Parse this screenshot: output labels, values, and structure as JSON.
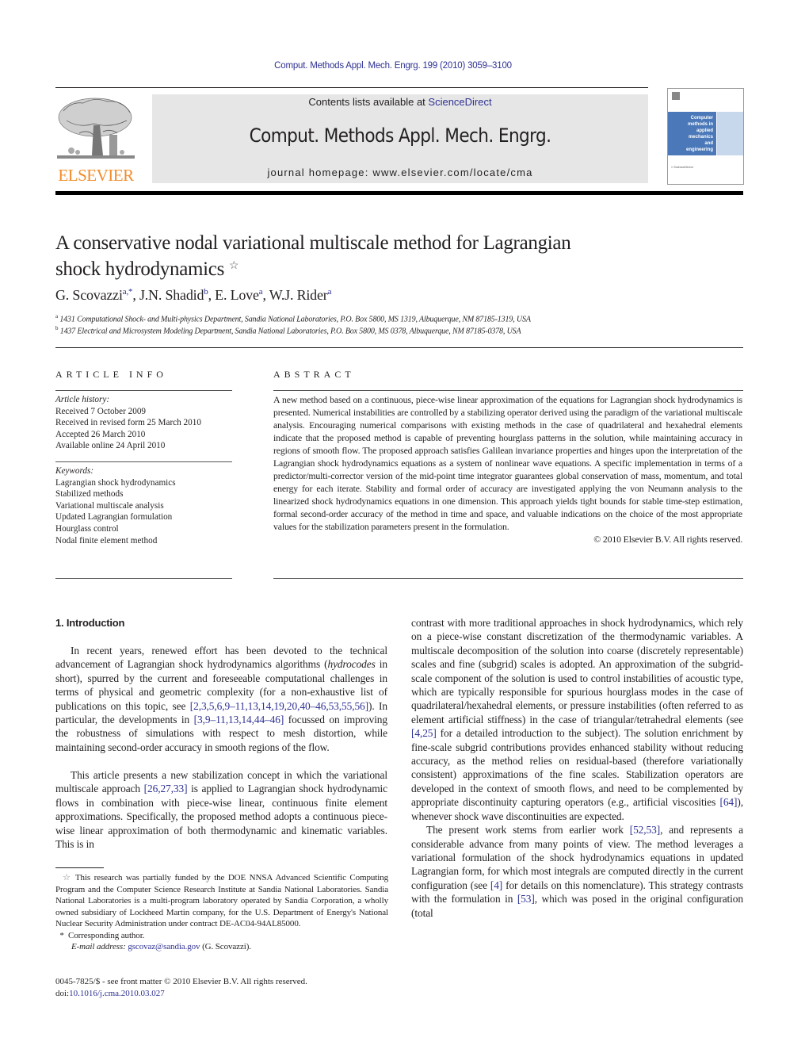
{
  "header": {
    "citation": "Comput. Methods Appl. Mech. Engrg. 199 (2010) 3059–3100",
    "publisher_logo_text": "ELSEVIER",
    "contents_prefix": "Contents lists available at ",
    "contents_link": "ScienceDirect",
    "journal_title": "Comput. Methods Appl. Mech. Engrg.",
    "homepage_prefix": "journal homepage: ",
    "homepage_url": "www.elsevier.com/locate/cma",
    "cover": {
      "lines": [
        "Computer",
        "methods in",
        "applied",
        "mechanics",
        "and",
        "engineering"
      ],
      "colors": {
        "blue": "#4a78b8",
        "light_blue": "#c8d8ec"
      }
    }
  },
  "article": {
    "title_line1": "A conservative nodal variational multiscale method for Lagrangian",
    "title_line2": "shock hydrodynamics",
    "title_mark": "☆",
    "authors": [
      {
        "name": "G. Scovazzi",
        "sup": "a,*"
      },
      {
        "name": "J.N. Shadid",
        "sup": "b"
      },
      {
        "name": "E. Love",
        "sup": "a"
      },
      {
        "name": "W.J. Rider",
        "sup": "a"
      }
    ],
    "affiliations": [
      {
        "label": "a",
        "text": "1431 Computational Shock- and Multi-physics Department, Sandia National Laboratories, P.O. Box 5800, MS 1319, Albuquerque, NM 87185-1319, USA"
      },
      {
        "label": "b",
        "text": "1437 Electrical and Microsystem Modeling Department, Sandia National Laboratories, P.O. Box 5800, MS 0378, Albuquerque, NM 87185-0378, USA"
      }
    ]
  },
  "article_info": {
    "heading": "ARTICLE INFO",
    "history_label": "Article history:",
    "history": [
      "Received 7 October 2009",
      "Received in revised form 25 March 2010",
      "Accepted 26 March 2010",
      "Available online 24 April 2010"
    ],
    "keywords_label": "Keywords:",
    "keywords": [
      "Lagrangian shock hydrodynamics",
      "Stabilized methods",
      "Variational multiscale analysis",
      "Updated Lagrangian formulation",
      "Hourglass control",
      "Nodal finite element method"
    ]
  },
  "abstract": {
    "heading": "ABSTRACT",
    "text": "A new method based on a continuous, piece-wise linear approximation of the equations for Lagrangian shock hydrodynamics is presented. Numerical instabilities are controlled by a stabilizing operator derived using the paradigm of the variational multiscale analysis. Encouraging numerical comparisons with existing methods in the case of quadrilateral and hexahedral elements indicate that the proposed method is capable of preventing hourglass patterns in the solution, while maintaining accuracy in regions of smooth flow. The proposed approach satisfies Galilean invariance properties and hinges upon the interpretation of the Lagrangian shock hydrodynamics equations as a system of nonlinear wave equations. A specific implementation in terms of a predictor/multi-corrector version of the mid-point time integrator guarantees global conservation of mass, momentum, and total energy for each iterate. Stability and formal order of accuracy are investigated applying the von Neumann analysis to the linearized shock hydrodynamics equations in one dimension. This approach yields tight bounds for stable time-step estimation, formal second-order accuracy of the method in time and space, and valuable indications on the choice of the most appropriate values for the stabilization parameters present in the formulation.",
    "copyright": "© 2010 Elsevier B.V. All rights reserved."
  },
  "body": {
    "section_heading": "1. Introduction",
    "p1": {
      "a": "In recent years, renewed effort has been devoted to the technical advancement of Lagrangian shock hydrodynamics algorithms (",
      "italic": "hydrocodes",
      "b": " in short), spurred by the current and foreseeable computational challenges in terms of physical and geometric complexity (for a non-exhaustive list of publications on this topic, see ",
      "ref1": "[2,3,5,6,9–11,13,14,19,20,40–46,53,55,56]",
      "c": "). In particular, the developments in ",
      "ref2": "[3,9–11,13,14,44–46]",
      "d": " focussed on improving the robustness of simulations with respect to mesh distortion, while maintaining second-order accuracy in smooth regions of the flow."
    },
    "p2": {
      "a": "This article presents a new stabilization concept in which the variational multiscale approach ",
      "ref1": "[26,27,33]",
      "b": " is applied to Lagrangian shock hydrodynamic flows in combination with piece-wise linear, continuous finite element approximations. Specifically, the proposed method adopts a continuous piece-wise linear approximation of both thermodynamic and kinematic variables. This is in contrast with more traditional approaches in shock hydrodynamics, which rely on a piece-wise constant discretization of the thermodynamic variables. A multiscale decomposition of the solution into coarse (discretely representable) scales and fine (subgrid) scales is adopted. An approximation of the subgrid-scale component of the solution is used to control instabilities of acoustic type, which are typically responsible for spurious hourglass modes in the case of quadrilateral/hexahedral elements, or pressure instabilities (often referred to as element artificial stiffness) in the case of triangular/tetrahedral elements (see ",
      "ref2": "[4,25]",
      "c": " for a detailed introduction to the subject). The solution enrichment by fine-scale subgrid contributions provides enhanced stability without reducing accuracy, as the method relies on residual-based (therefore variationally consistent) approximations of the fine scales. Stabilization operators are developed in the context of smooth flows, and need to be complemented by appropriate discontinuity capturing operators (e.g., artificial viscosities ",
      "ref3": "[64]",
      "d": "), whenever shock wave discontinuities are expected."
    },
    "p3": {
      "a": "The present work stems from earlier work ",
      "ref1": "[52,53]",
      "b": ", and represents a considerable advance from many points of view. The method leverages a variational formulation of the shock hydrodynamics equations in updated Lagrangian form, for which most integrals are computed directly in the current configuration (see ",
      "ref2": "[4]",
      "c": " for details on this nomenclature). This strategy contrasts with the formulation in ",
      "ref3": "[53]",
      "d": ", which was posed in the original configuration (total"
    }
  },
  "footnotes": {
    "funding_mark": "☆",
    "funding": "This research was partially funded by the DOE NNSA Advanced Scientific Computing Program and the Computer Science Research Institute at Sandia National Laboratories. Sandia National Laboratories is a multi-program laboratory operated by Sandia Corporation, a wholly owned subsidiary of Lockheed Martin company, for the U.S. Department of Energy's National Nuclear Security Administration under contract DE-AC04-94AL85000.",
    "corr_mark": "*",
    "corresponding": "Corresponding author.",
    "email_label": "E-mail address: ",
    "email": "gscovaz@sandia.gov",
    "email_suffix": " (G. Scovazzi)."
  },
  "front_matter": {
    "issn_line": "0045-7825/$ - see front matter © 2010 Elsevier B.V. All rights reserved.",
    "doi_label": "doi:",
    "doi": "10.1016/j.cma.2010.03.027"
  }
}
